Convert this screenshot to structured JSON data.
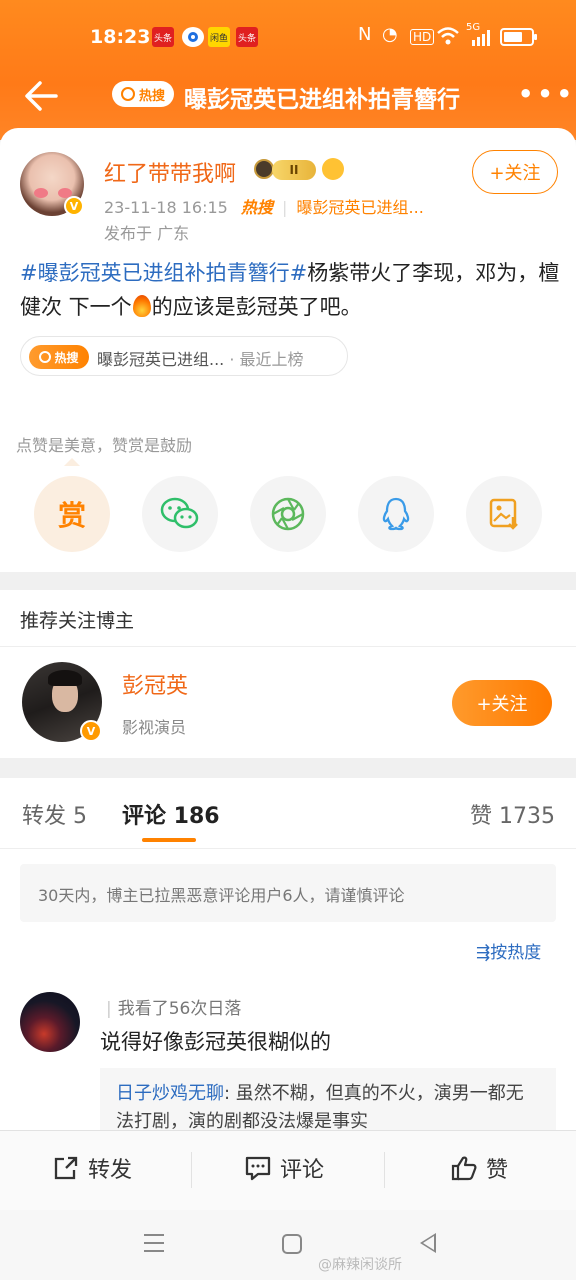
{
  "status_bar": {
    "time": "18:23",
    "notifications": [
      "头条",
      "",
      "闲鱼",
      "头条"
    ],
    "signal": "5G"
  },
  "nav": {
    "hot_tag": "热搜",
    "title": "曝彭冠英已进组补拍青簪行",
    "more": "•••"
  },
  "post": {
    "username": "红了带带我啊",
    "level": "II",
    "timestamp": "23-11-18 16:15",
    "hot_logo": "热搜",
    "topic_short": "曝彭冠英已进组...",
    "location": "发布于 广东",
    "follow_label": "+关注",
    "hashtag": "#曝彭冠英已进组补拍青簪行#",
    "text_part1": "杨紫带火了李现，邓为，檀健次 下一个",
    "text_part2": "的应该是彭冠英了吧。",
    "topic_chip": {
      "badge": "热搜",
      "topic": "曝彭冠英已进组...",
      "status": "· 最近上榜"
    }
  },
  "reward": {
    "hint": "点赞是美意，赞赏是鼓励",
    "reward_label": "赏",
    "icons": [
      "wechat-icon",
      "moments-icon",
      "qq-icon",
      "save-image-icon"
    ]
  },
  "recommend": {
    "title": "推荐关注博主",
    "name": "彭冠英",
    "desc": "影视演员",
    "follow_label": "+关注"
  },
  "tabs": {
    "repost": "转发 5",
    "comments": "评论 186",
    "likes": "赞 1735"
  },
  "comments": {
    "notice": "30天内，博主已拉黑恶意评论用户6人，请谨慎评论",
    "sort": "按热度",
    "items": [
      {
        "user": "我看了56次日落",
        "text": "说得好像彭冠英很糊似的",
        "reply_name": "日子炒鸡无聊",
        "reply_text": ": 虽然不糊，但真的不火，演男一都无法打剧，演的剧都没法爆是事实"
      }
    ]
  },
  "actions": {
    "repost": "转发",
    "comment": "评论",
    "like": "赞"
  },
  "watermark": "@麻辣闲谈所",
  "colors": {
    "brand_orange": "#ff8200",
    "link_blue": "#2d6cc0",
    "username_orange": "#f06818"
  }
}
